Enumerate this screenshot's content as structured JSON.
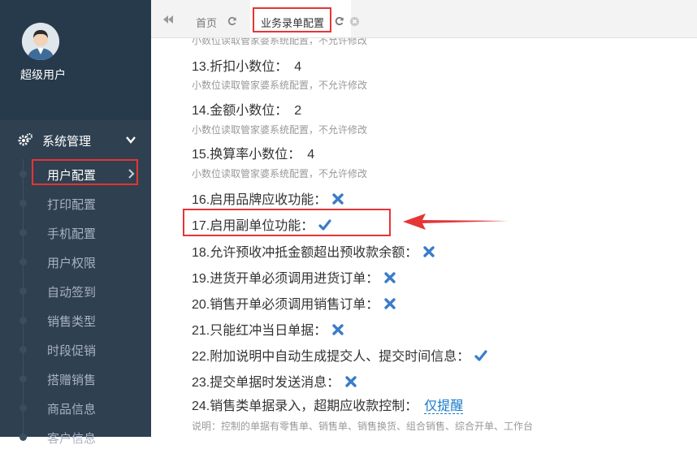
{
  "user": {
    "name": "超级用户"
  },
  "menu": {
    "section_label": "系统管理",
    "items": [
      {
        "label": "用户配置"
      },
      {
        "label": "打印配置"
      },
      {
        "label": "手机配置"
      },
      {
        "label": "用户权限"
      },
      {
        "label": "自动签到"
      },
      {
        "label": "销售类型"
      },
      {
        "label": "时段促销"
      },
      {
        "label": "搭赠销售"
      },
      {
        "label": "商品信息"
      },
      {
        "label": "客户信息"
      }
    ]
  },
  "tabs": [
    {
      "label": "首页"
    },
    {
      "label": "业务录单配置"
    }
  ],
  "settings": {
    "top_note": "小数位读取管家婆系统配置，不允许修改",
    "r13": {
      "label": "13.折扣小数位：",
      "value": "4",
      "note": "小数位读取管家婆系统配置，不允许修改"
    },
    "r14": {
      "label": "14.金额小数位：",
      "value": "2",
      "note": "小数位读取管家婆系统配置，不允许修改"
    },
    "r15": {
      "label": "15.换算率小数位：",
      "value": "4",
      "note": "小数位读取管家婆系统配置，不允许修改"
    },
    "r16": {
      "label": "16.启用品牌应收功能：",
      "state": "off"
    },
    "r17": {
      "label": "17.启用副单位功能：",
      "state": "on"
    },
    "r18": {
      "label": "18.允许预收冲抵金额超出预收款余额：",
      "state": "off"
    },
    "r19": {
      "label": "19.进货开单必须调用进货订单：",
      "state": "off"
    },
    "r20": {
      "label": "20.销售开单必须调用销售订单：",
      "state": "off"
    },
    "r21": {
      "label": "21.只能红冲当日单据：",
      "state": "off"
    },
    "r22": {
      "label": "22.附加说明中自动生成提交人、提交时间信息：",
      "state": "on"
    },
    "r23": {
      "label": "23.提交单据时发送消息：",
      "state": "off"
    },
    "r24": {
      "label": "24.销售类单据录入，超期应收款控制：",
      "link": "仅提醒",
      "note": "说明：控制的单据有零售单、销售单、销售换货、组合销售、综合开单、工作台"
    }
  },
  "colors": {
    "sidebar_bg": "#2f4050",
    "icon_blue": "#3a7cc7",
    "highlight_red": "#e63535"
  }
}
